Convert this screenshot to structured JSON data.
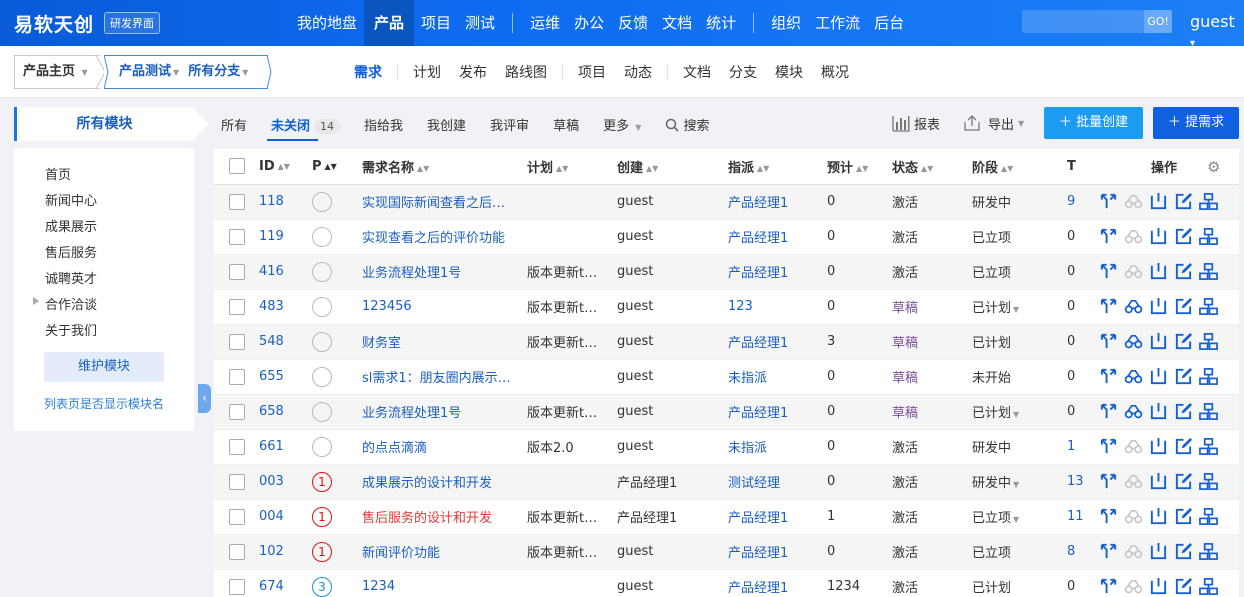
{
  "header": {
    "brand": "易软天创",
    "badge": "研发界面",
    "nav": [
      "我的地盘",
      "产品",
      "项目",
      "测试",
      "运维",
      "办公",
      "反馈",
      "文档",
      "统计",
      "组织",
      "工作流",
      "后台"
    ],
    "active_nav": "产品",
    "go_label": "GO!",
    "user": "guest"
  },
  "breadcrumb": {
    "home": "产品主页",
    "product": "产品测试",
    "branch": "所有分支"
  },
  "subnav": [
    "需求",
    "计划",
    "发布",
    "路线图",
    "项目",
    "动态",
    "文档",
    "分支",
    "模块",
    "概况"
  ],
  "sidebar": {
    "title": "所有模块",
    "items": [
      "首页",
      "新闻中心",
      "成果展示",
      "售后服务",
      "诚聘英才",
      "合作洽谈",
      "关于我们"
    ],
    "maintain_btn": "维护模块",
    "link": "列表页是否显示模块名"
  },
  "filters": {
    "all": "所有",
    "unclosed": "未关闭",
    "unclosed_count": "14",
    "assigned": "指给我",
    "created": "我创建",
    "review": "我评审",
    "draft": "草稿",
    "more": "更多",
    "search": "搜索"
  },
  "toolbar": {
    "report": "报表",
    "export": "导出",
    "batch_create": "批量创建",
    "add_story": "提需求"
  },
  "table": {
    "headers": {
      "id": "ID",
      "p": "P",
      "name": "需求名称",
      "plan": "计划",
      "creator": "创建",
      "assignee": "指派",
      "estimate": "预计",
      "status": "状态",
      "stage": "阶段",
      "t": "T",
      "actions": "操作"
    },
    "rows": [
      {
        "id": "118",
        "pri": "",
        "name": "实现国际新闻查看之后…",
        "plan": "",
        "creator": "guest",
        "assignee": "产品经理1",
        "est": "0",
        "status": "激活",
        "stage": "研发中",
        "t": "9"
      },
      {
        "id": "119",
        "pri": "",
        "name": "实现查看之后的评价功能",
        "plan": "",
        "creator": "guest",
        "assignee": "产品经理1",
        "est": "0",
        "status": "激活",
        "stage": "已立项",
        "t": "0"
      },
      {
        "id": "416",
        "pri": "",
        "name": "业务流程处理1号",
        "plan": "版本更新t…",
        "creator": "guest",
        "assignee": "产品经理1",
        "est": "0",
        "status": "激活",
        "stage": "已立项",
        "t": "0"
      },
      {
        "id": "483",
        "pri": "",
        "name": "123456",
        "plan": "版本更新t…",
        "creator": "guest",
        "assignee": "123",
        "est": "0",
        "status": "草稿",
        "stage": "已计划",
        "t": "0"
      },
      {
        "id": "548",
        "pri": "",
        "name": "财务室",
        "plan": "版本更新t…",
        "creator": "guest",
        "assignee": "产品经理1",
        "est": "3",
        "status": "草稿",
        "stage": "已计划",
        "t": "0"
      },
      {
        "id": "655",
        "pri": "",
        "name": "sl需求1：朋友圈内展示…",
        "plan": "",
        "creator": "guest",
        "assignee": "未指派",
        "est": "0",
        "status": "草稿",
        "stage": "未开始",
        "t": "0"
      },
      {
        "id": "658",
        "pri": "",
        "name": "业务流程处理1号",
        "plan": "版本更新t…",
        "creator": "guest",
        "assignee": "产品经理1",
        "est": "0",
        "status": "草稿",
        "stage": "已计划",
        "t": "0"
      },
      {
        "id": "661",
        "pri": "",
        "name": "的点点滴滴",
        "plan": "版本2.0",
        "creator": "guest",
        "assignee": "未指派",
        "est": "0",
        "status": "激活",
        "stage": "研发中",
        "t": "1"
      },
      {
        "id": "003",
        "pri": "1",
        "name": "成果展示的设计和开发",
        "plan": "",
        "creator": "产品经理1",
        "assignee": "测试经理",
        "est": "0",
        "status": "激活",
        "stage": "研发中",
        "t": "13"
      },
      {
        "id": "004",
        "pri": "1",
        "name": "售后服务的设计和开发",
        "plan": "版本更新t…",
        "creator": "产品经理1",
        "assignee": "产品经理1",
        "est": "1",
        "status": "激活",
        "stage": "已立项",
        "t": "11"
      },
      {
        "id": "102",
        "pri": "1",
        "name": "新闻评价功能",
        "plan": "版本更新t…",
        "creator": "guest",
        "assignee": "产品经理1",
        "est": "0",
        "status": "激活",
        "stage": "已立项",
        "t": "8"
      },
      {
        "id": "674",
        "pri": "3",
        "name": "1234",
        "plan": "",
        "creator": "guest",
        "assignee": "产品经理1",
        "est": "1234",
        "status": "激活",
        "stage": "已计划",
        "t": "0"
      }
    ]
  }
}
